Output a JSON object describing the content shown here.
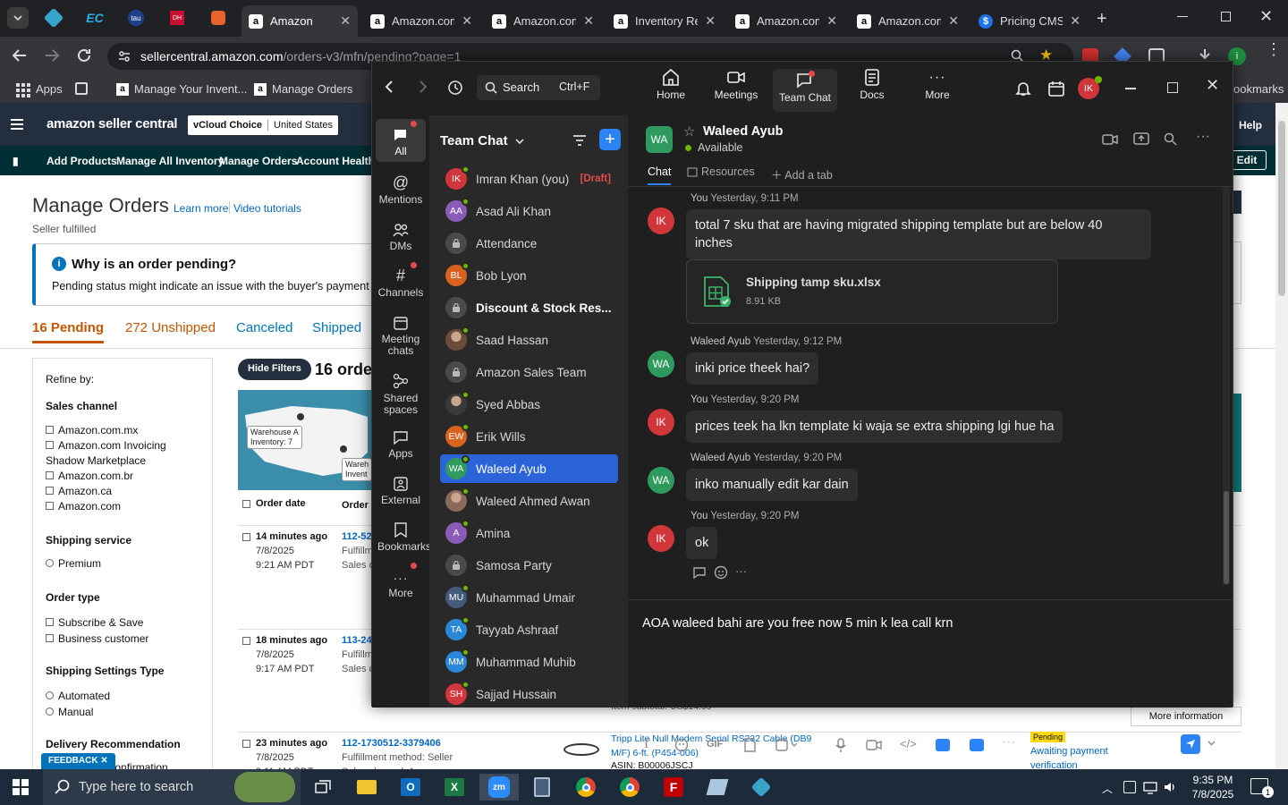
{
  "browser": {
    "tabs": [
      {
        "label": "Amazon",
        "active": true
      },
      {
        "label": "Amazon.com",
        "active": false
      },
      {
        "label": "Amazon.com",
        "active": false
      },
      {
        "label": "Inventory Re",
        "active": false
      },
      {
        "label": "Amazon.com",
        "active": false
      },
      {
        "label": "Amazon.com",
        "active": false
      },
      {
        "label": "Pricing CMS",
        "active": false
      }
    ],
    "url_host": "sellercentral.amazon.com",
    "url_path": "/orders-v3/mfn/pending?page=1",
    "bookmarks": [
      "Apps",
      "Manage Your Invent...",
      "Manage Orders"
    ],
    "bookmarks_right": "ookmarks"
  },
  "amazon": {
    "logo": "amazon seller central",
    "account": "vCloud Choice",
    "marketplace": "United States",
    "help": "Help",
    "edit": "Edit",
    "nav": [
      "Add Products",
      "Manage All Inventory",
      "Manage Orders",
      "Account Health"
    ],
    "title": "Manage Orders",
    "learn_more": "Learn more",
    "video_tutorials": "Video tutorials",
    "subtitle": "Seller fulfilled",
    "notice_title": "Why is an order pending?",
    "notice_text": "Pending status might indicate an issue with the buyer's payment meth",
    "order_tabs": [
      "16 Pending",
      "272 Unshipped",
      "Canceled",
      "Shipped"
    ],
    "refine_by": "Refine by:",
    "filters": [
      {
        "title": "Sales channel",
        "options": [
          "Amazon.com.mx",
          "Amazon.com Invoicing Shadow Marketplace",
          "Amazon.com.br",
          "Amazon.ca",
          "Amazon.com"
        ]
      },
      {
        "title": "Shipping service",
        "options": [
          "Premium"
        ]
      },
      {
        "title": "Order type",
        "options": [
          "Subscribe & Save",
          "Business customer"
        ]
      },
      {
        "title": "Shipping Settings Type",
        "options": [
          "Automated",
          "Manual"
        ]
      },
      {
        "title": "Delivery Recommendation",
        "options": [
          "Signature Confirmation"
        ]
      }
    ],
    "hide_filters": "Hide Filters",
    "orders_count": "16 orde",
    "map_label_a": "Warehouse A\nInventory: 7",
    "map_label_b": "Wareh\nInvent",
    "col_order_date": "Order date",
    "col_order": "Order",
    "orders": [
      {
        "ago": "14 minutes ago",
        "date": "7/8/2025",
        "time": "9:21 AM PDT",
        "id": "112-52",
        "line2": "Fulfillm",
        "line3": "Sales ch"
      },
      {
        "ago": "18 minutes ago",
        "date": "7/8/2025",
        "time": "9:17 AM PDT",
        "id": "113-24",
        "line2": "Fulfillm",
        "line3": "Sales ch"
      },
      {
        "ago": "23 minutes ago",
        "date": "7/8/2025",
        "time": "9:11 AM PDT",
        "id": "112-1730512-3379406",
        "line2": "Fulfillment method: Seller",
        "line3": "Sales channel: Amazon.com"
      }
    ],
    "product_title": "Tripp Lite Null Modem Serial RS232 Cable (DB9 M/F) 6-ft. (P454-006)",
    "asin": "ASIN: B00006JSCJ",
    "item_subtotal": "Item subtotal: US$14.99",
    "status_badge": "Pending",
    "status_text": "Awaiting payment",
    "status_link": "verification",
    "more_info": "More information",
    "feedback": "FEEDBACK"
  },
  "teams": {
    "search_placeholder": "Search",
    "search_shortcut": "Ctrl+F",
    "top_nav": [
      "Home",
      "Meetings",
      "Team Chat",
      "Docs",
      "More"
    ],
    "profile_initials": "IK",
    "rail": [
      "All",
      "Mentions",
      "DMs",
      "Channels",
      "Meeting chats",
      "Shared spaces",
      "Apps",
      "External",
      "Bookmarks",
      "More"
    ],
    "list_title": "Team Chat",
    "chats": [
      {
        "name": "Imran Khan (you)",
        "initials": "IK",
        "color": "#d1363a",
        "draft": "[Draft]",
        "type": "avatar"
      },
      {
        "name": "Asad Ali Khan",
        "initials": "AA",
        "color": "#8b5bb8",
        "type": "avatar"
      },
      {
        "name": "Attendance",
        "initials": "",
        "color": "#4a4a4a",
        "type": "lock"
      },
      {
        "name": "Bob Lyon",
        "initials": "BL",
        "color": "#d8631f",
        "type": "avatar"
      },
      {
        "name": "Discount & Stock Res...",
        "initials": "",
        "color": "#4a4a4a",
        "type": "lock",
        "bold": true
      },
      {
        "name": "Saad Hassan",
        "initials": "",
        "color": "#6b4b3a",
        "type": "photo"
      },
      {
        "name": "Amazon Sales Team",
        "initials": "",
        "color": "#4a4a4a",
        "type": "lock"
      },
      {
        "name": "Syed Abbas",
        "initials": "",
        "color": "#3a3a3a",
        "type": "photo"
      },
      {
        "name": "Erik Wills",
        "initials": "EW",
        "color": "#d8631f",
        "type": "avatar"
      },
      {
        "name": "Waleed Ayub",
        "initials": "WA",
        "color": "#2f9a5e",
        "type": "avatar",
        "selected": true
      },
      {
        "name": "Waleed Ahmed Awan",
        "initials": "",
        "color": "#8a6a5a",
        "type": "photo"
      },
      {
        "name": "Amina",
        "initials": "A",
        "color": "#8b5bb8",
        "type": "avatar"
      },
      {
        "name": "Samosa Party",
        "initials": "",
        "color": "#4a4a4a",
        "type": "lock"
      },
      {
        "name": "Muhammad Umair",
        "initials": "MU",
        "color": "#445a7a",
        "type": "avatar"
      },
      {
        "name": "Tayyab Ashraaf",
        "initials": "TA",
        "color": "#2b88d8",
        "type": "avatar"
      },
      {
        "name": "Muhammad Muhib",
        "initials": "MM",
        "color": "#2b88d8",
        "type": "avatar"
      },
      {
        "name": "Sajjad Hussain",
        "initials": "SH",
        "color": "#d1363a",
        "type": "avatar"
      }
    ],
    "contact": {
      "name": "Waleed Ayub",
      "status": "Available",
      "initials": "WA"
    },
    "conv_tabs": [
      "Chat",
      "Resources",
      "Add a tab"
    ],
    "messages": [
      {
        "sender": "You",
        "time": "Yesterday, 9:11 PM",
        "initials": "IK",
        "color": "#d1363a",
        "text": "total 7 sku that are having migrated shipping template but are below 40 inches"
      },
      {
        "sender": "Waleed Ayub",
        "time": "Yesterday, 9:12 PM",
        "initials": "WA",
        "color": "#2f9a5e",
        "text": "inki price theek hai?"
      },
      {
        "sender": "You",
        "time": "Yesterday, 9:20 PM",
        "initials": "IK",
        "color": "#d1363a",
        "text": "prices teek ha lkn template ki waja se extra shipping lgi hue ha"
      },
      {
        "sender": "Waleed Ayub",
        "time": "Yesterday, 9:20 PM",
        "initials": "WA",
        "color": "#2f9a5e",
        "text": "inko manually edit kar dain"
      },
      {
        "sender": "You",
        "time": "Yesterday, 9:20 PM",
        "initials": "IK",
        "color": "#d1363a",
        "text": "ok"
      }
    ],
    "attachment": {
      "name": "Shipping tamp sku.xlsx",
      "size": "8.91 KB"
    },
    "compose_text": "AOA waleed bahi are you free now 5 min k lea call krn"
  },
  "taskbar": {
    "search_placeholder": "Type here to search",
    "time": "9:35 PM",
    "date": "7/8/2025",
    "notif_count": "1"
  }
}
